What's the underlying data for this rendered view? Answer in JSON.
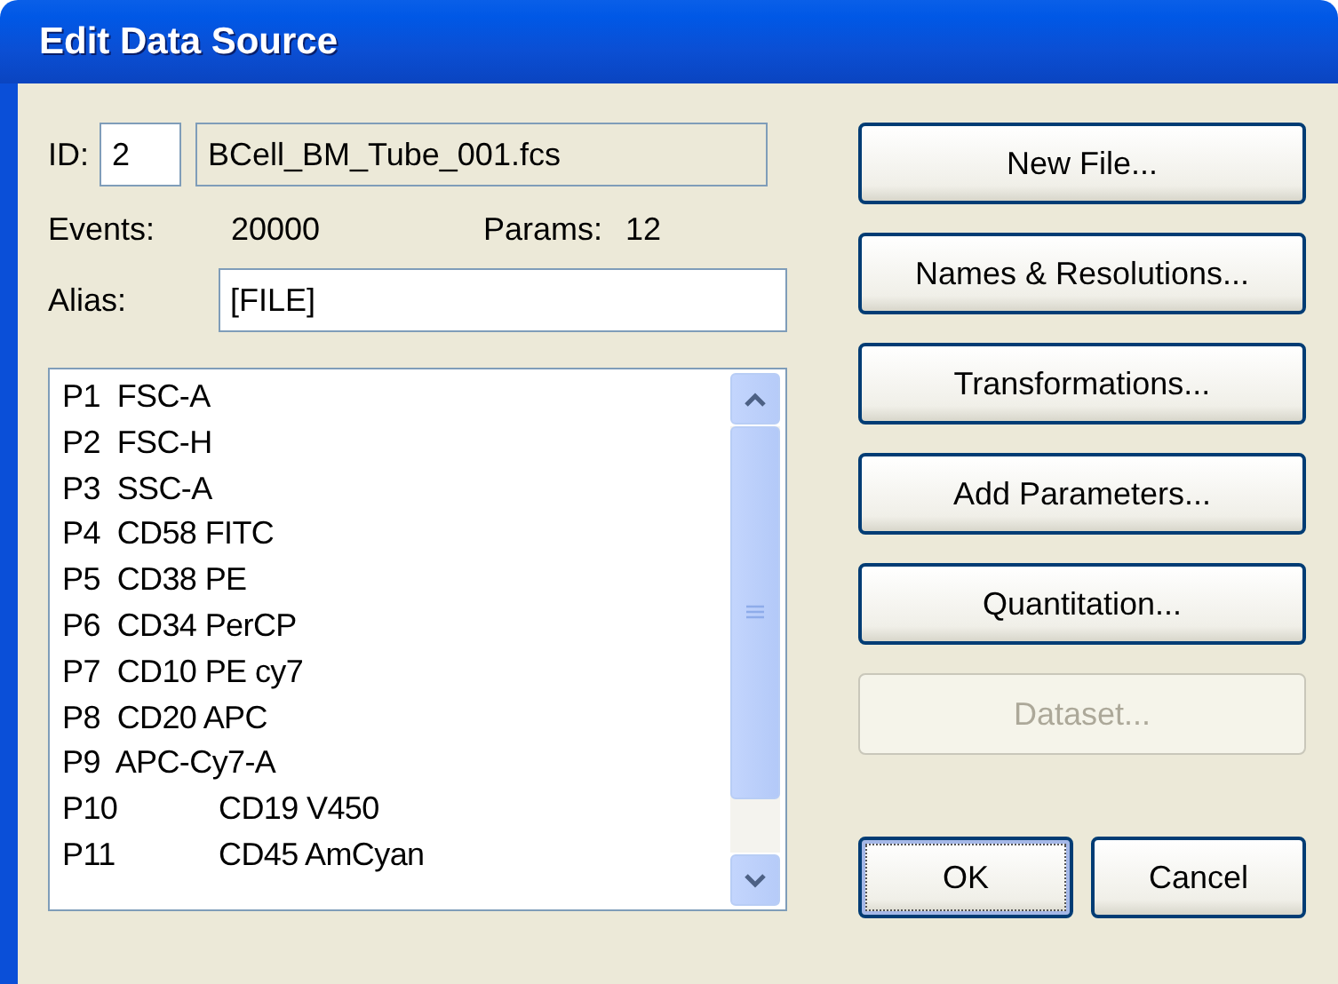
{
  "window": {
    "title": "Edit Data Source"
  },
  "id": {
    "label": "ID:",
    "value": "2"
  },
  "file": {
    "value": "BCell_BM_Tube_001.fcs"
  },
  "events": {
    "label": "Events:",
    "value": "20000"
  },
  "params": {
    "label": "Params:",
    "value": "12"
  },
  "alias": {
    "label": "Alias:",
    "value": "[FILE]"
  },
  "parameters": [
    "P1  FSC-A",
    "P2  FSC-H",
    "P3  SSC-A",
    "P4  CD58 FITC",
    "P5  CD38 PE",
    "P6  CD34 PerCP",
    "P7  CD10 PE cy7",
    "P8  CD20 APC",
    "P9  APC-Cy7-A",
    "P10\tCD19 V450",
    "P11\tCD45 AmCyan"
  ],
  "buttons": [
    {
      "label": "New File...",
      "disabled": false
    },
    {
      "label": "Names & Resolutions...",
      "disabled": false
    },
    {
      "label": "Transformations...",
      "disabled": false
    },
    {
      "label": "Add Parameters...",
      "disabled": false
    },
    {
      "label": "Quantitation...",
      "disabled": false
    },
    {
      "label": "Dataset...",
      "disabled": true
    }
  ],
  "footer_buttons": [
    {
      "label": "OK",
      "focused": true
    },
    {
      "label": "Cancel",
      "focused": false
    }
  ]
}
